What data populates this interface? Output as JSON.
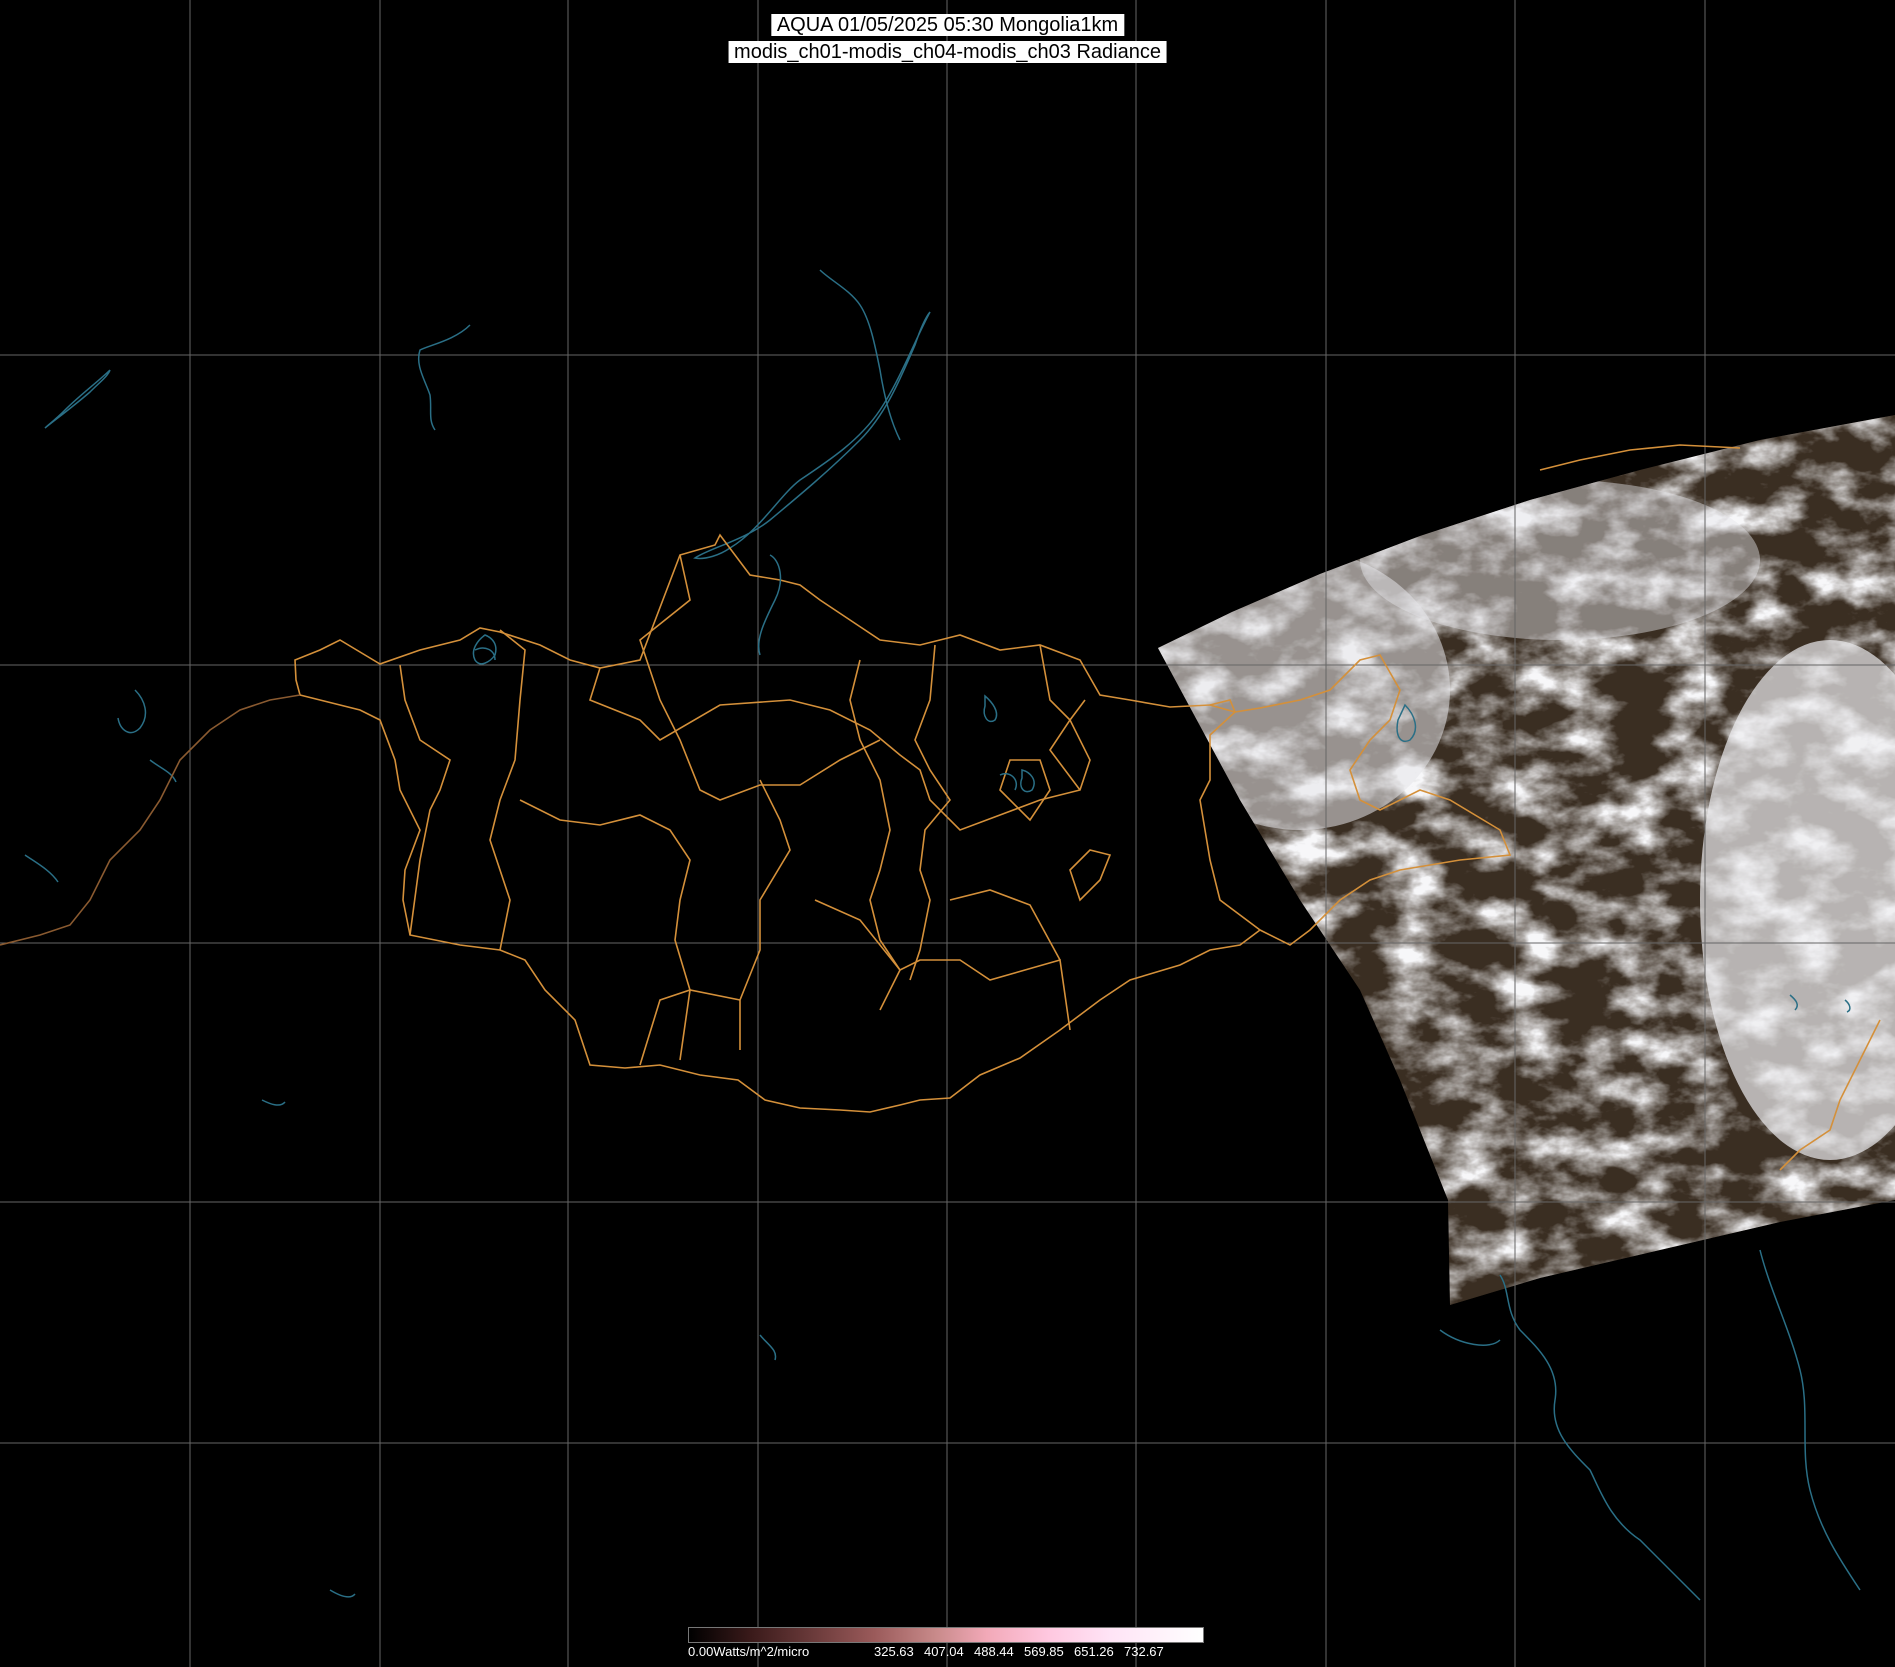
{
  "header": {
    "line1": "AQUA 01/05/2025 05:30 Mongolia1km",
    "line2": "modis_ch01-modis_ch04-modis_ch03 Radiance"
  },
  "colorbar": {
    "unit_label": "0.00Watts/m^2/micro",
    "ticks": [
      "325.63",
      "407.04",
      "488.44",
      "569.85",
      "651.26",
      "732.67"
    ]
  },
  "colors": {
    "background": "#000000",
    "graticule": "#666666",
    "borders": "#d4903a",
    "coast_water": "#2a6f86",
    "title_bg": "#ffffff"
  }
}
